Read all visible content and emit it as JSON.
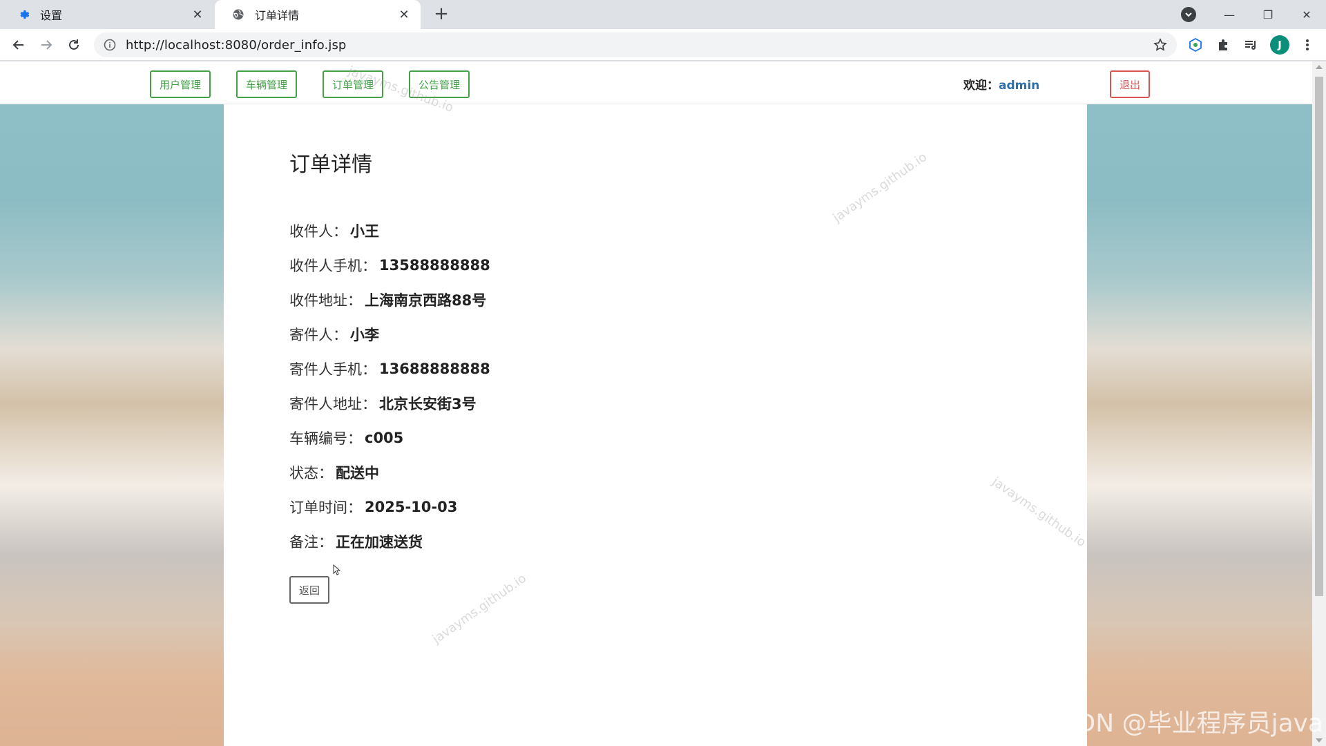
{
  "browser": {
    "tabs": [
      {
        "title": "设置",
        "icon": "gear-icon",
        "active": false
      },
      {
        "title": "订单详情",
        "icon": "globe-icon",
        "active": true
      }
    ],
    "url_host": "http://localhost:8080",
    "url_path": "/order_info.jsp",
    "profile_initial": "J"
  },
  "navbar": {
    "links": [
      "用户管理",
      "车辆管理",
      "订单管理",
      "公告管理"
    ],
    "welcome_label": "欢迎：",
    "username": "admin",
    "logout_label": "退出"
  },
  "order": {
    "title": "订单详情",
    "fields": [
      {
        "label": "收件人：",
        "value": "小王"
      },
      {
        "label": "收件人手机：",
        "value": "13588888888"
      },
      {
        "label": "收件地址：",
        "value": "上海南京西路88号"
      },
      {
        "label": "寄件人：",
        "value": "小李"
      },
      {
        "label": "寄件人手机：",
        "value": "13688888888"
      },
      {
        "label": "寄件人地址：",
        "value": "北京长安街3号"
      },
      {
        "label": "车辆编号：",
        "value": "c005"
      },
      {
        "label": "状态： ",
        "value": "配送中"
      },
      {
        "label": "订单时间：",
        "value": "2025-10-03"
      },
      {
        "label": "备注：",
        "value": "正在加速送货"
      }
    ],
    "back_label": "返回"
  },
  "watermark_text": "javayms.github.io",
  "csdn_text": "CSDN @毕业程序员java",
  "colors": {
    "nav_green": "#43a047",
    "logout_red": "#d9534f",
    "username_blue": "#2a6fb0"
  }
}
